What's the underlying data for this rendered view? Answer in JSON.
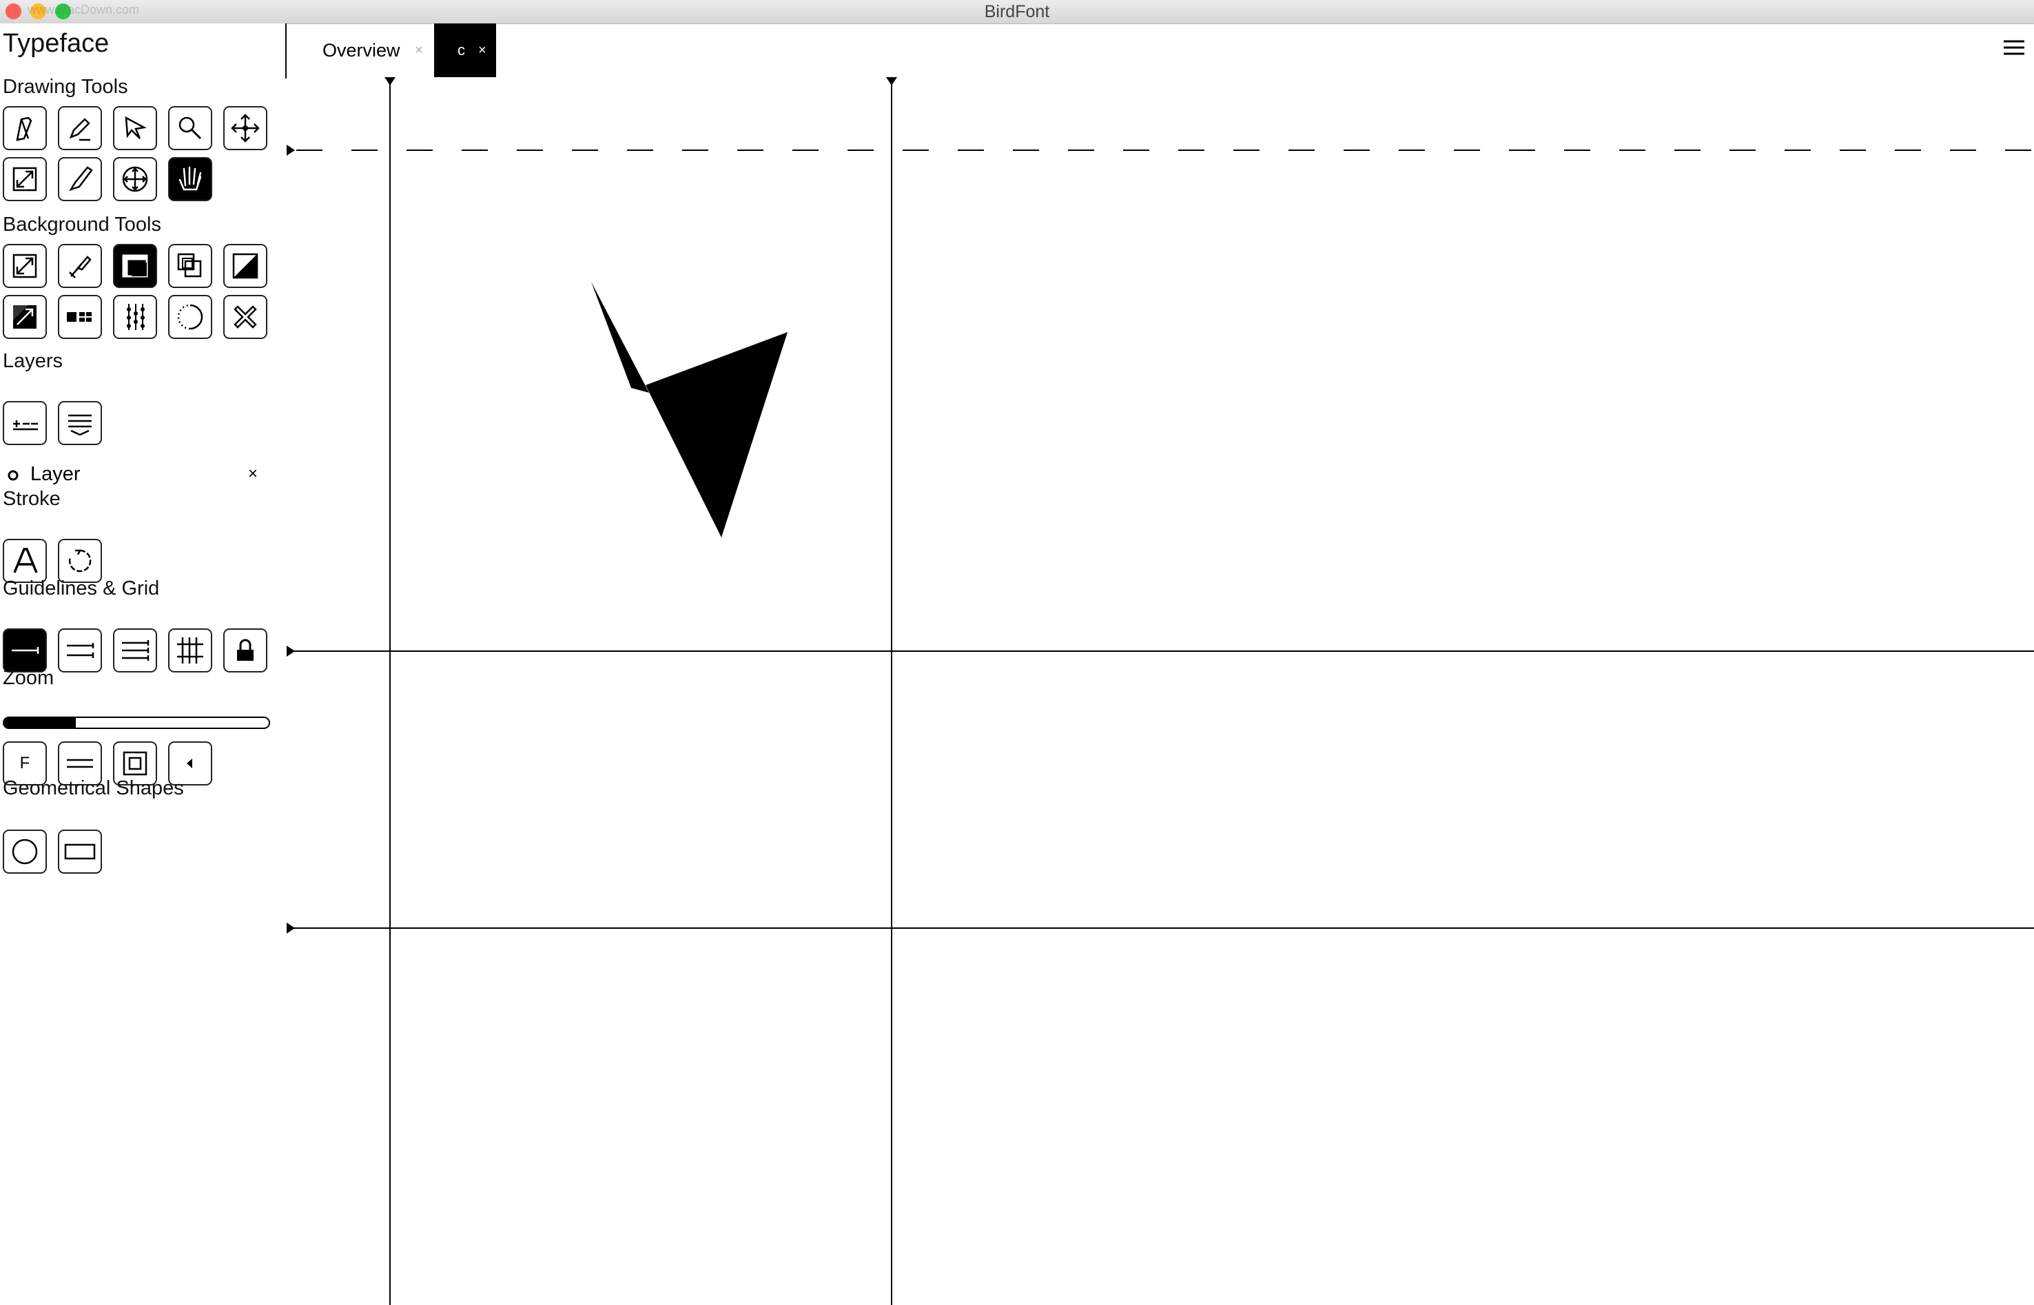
{
  "window": {
    "title": "BirdFont",
    "watermark": "www.MacDown.com",
    "traffic_colors": [
      "#fd5f57",
      "#febc2e",
      "#28c840"
    ]
  },
  "sidebar": {
    "title": "Typeface",
    "sections": {
      "drawing_tools": "Drawing Tools",
      "background_tools": "Background Tools",
      "layers": "Layers",
      "stroke": "Stroke",
      "guidelines": "Guidelines & Grid",
      "zoom": "Zoom",
      "shapes": "Geometrical Shapes"
    },
    "drawing_tools": [
      "pen-icon",
      "pencil-icon",
      "pointer-icon",
      "zoom-icon",
      "move-icon",
      "resize-icon",
      "brush-icon",
      "crosshair-move-icon",
      "hand-icon"
    ],
    "active_drawing_tool": "hand-icon",
    "background_tools": [
      "scale-icon",
      "crop-icon",
      "frame-icon",
      "overlap-icon",
      "contrast-icon",
      "threshold-icon",
      "blocks-icon",
      "dotted-lines-icon",
      "dotted-circle-icon",
      "cross-icon"
    ],
    "active_background_tool": "frame-icon",
    "layers": {
      "items": [
        {
          "name": "Layer",
          "remove": "×"
        }
      ]
    },
    "guidelines_active": "guide-single-icon",
    "zoom": {
      "level": 0.27,
      "fit_label": "F"
    }
  },
  "tabs": [
    {
      "label": "Overview",
      "close": "×",
      "active": false
    },
    {
      "label": "c",
      "close": "×",
      "active": true
    }
  ],
  "colors": {
    "accent": "#000000",
    "background": "#ffffff"
  }
}
